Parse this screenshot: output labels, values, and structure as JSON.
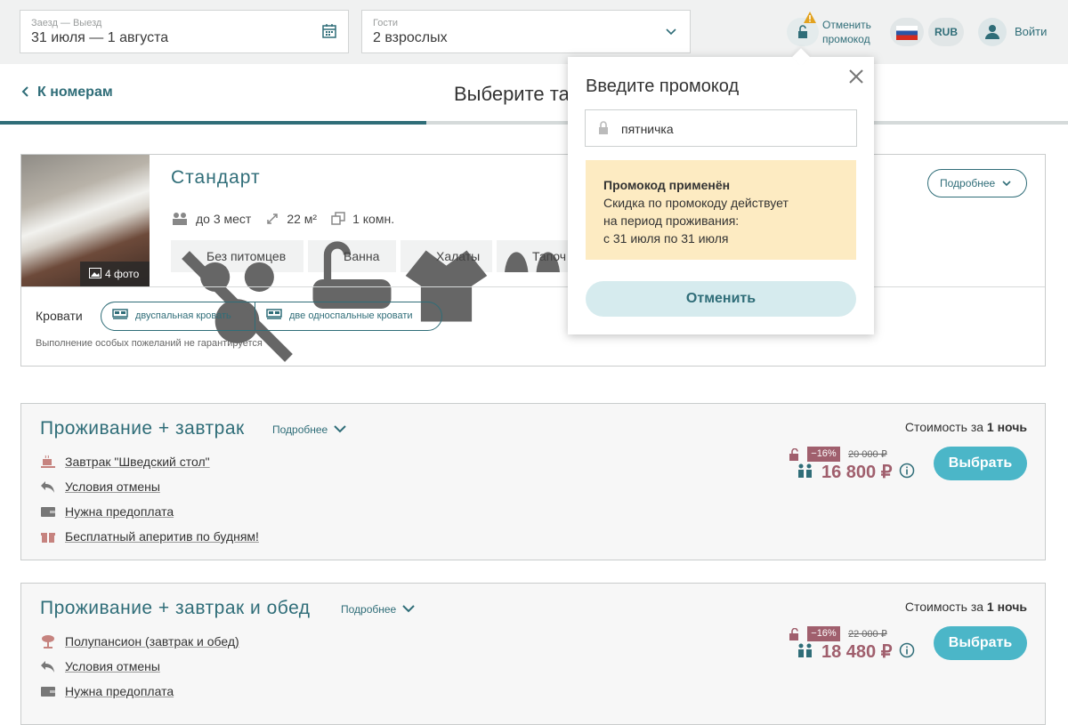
{
  "search": {
    "dates_label": "Заезд — Выезд",
    "dates_value": "31 июля — 1 августа",
    "guests_label": "Гости",
    "guests_value": "2 взрослых"
  },
  "header": {
    "cancel_promo_line1": "Отменить",
    "cancel_promo_line2": "промокод",
    "currency": "RUB",
    "login": "Войти"
  },
  "nav": {
    "back_label": "К номерам",
    "page_title": "Выберите та"
  },
  "room": {
    "name": "Стандарт",
    "photo_count": "4 фото",
    "capacity": "до 3 мест",
    "area": "22 м²",
    "rooms": "1 комн.",
    "details_button": "Подробнее",
    "amenities": [
      "Без питомцев",
      "Ванна",
      "Халаты",
      "Тапоч"
    ],
    "beds_label": "Кровати",
    "beds": [
      "двуспальная кровать",
      "две односпальные кровати"
    ],
    "note": "Выполнение особых пожеланий не гарантируется"
  },
  "tariffs": [
    {
      "title": "Проживание + завтрак",
      "more": "Подробнее",
      "price_label_prefix": "Стоимость за ",
      "price_label_bold": "1 ночь",
      "features": [
        "Завтрак \"Шведский стол\"",
        "Условия отмены",
        "Нужна предоплата",
        "Бесплатный аперитив по будням!"
      ],
      "discount": "−16%",
      "old_price": "20 000 ₽",
      "new_price": "16 800 ₽",
      "button": "Выбрать"
    },
    {
      "title": "Проживание + завтрак и обед",
      "more": "Подробнее",
      "price_label_prefix": "Стоимость за ",
      "price_label_bold": "1 ночь",
      "features": [
        "Полупансион (завтрак и обед)",
        "Условия отмены",
        "Нужна предоплата"
      ],
      "discount": "−16%",
      "old_price": "22 000 ₽",
      "new_price": "18 480 ₽",
      "button": "Выбрать"
    }
  ],
  "promo_popover": {
    "title": "Введите промокод",
    "code": "пятничка",
    "alert_title": "Промокод применён",
    "alert_line1": "Скидка по промокоду действует",
    "alert_line2": "на период проживания:",
    "alert_line3": "с 31 июля по 31 июля",
    "cancel_button": "Отменить"
  },
  "colors": {
    "accent": "#2f6d78",
    "button": "#4bb6c8",
    "price": "#a05f6d",
    "alert_bg": "#fdebc2"
  }
}
